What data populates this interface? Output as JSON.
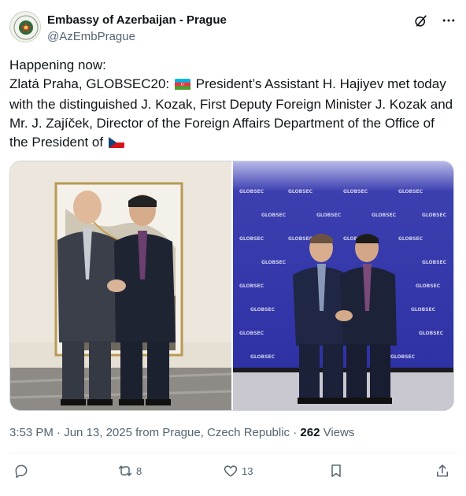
{
  "account": {
    "name": "Embassy of Azerbaijan - Prague",
    "handle": "@AzEmbPrague",
    "avatar_icon": "embassy-seal-icon"
  },
  "header_icons": [
    "grok-icon",
    "more-icon"
  ],
  "tweet": {
    "line1": "Happening now:",
    "line2_prefix": "Zlatá Praha, GLOBSEC20: ",
    "line2_suffix": " President’s Assistant H. Hajiyev met today with the distinguished J. Kozak, First Deputy Foreign Minister J. Kozak and Mr. J. Zajíček, Director of the Foreign Affairs Department of the Office of the President of ",
    "flags": [
      "azerbaijan-flag-icon",
      "czech-flag-icon"
    ]
  },
  "media": {
    "photo_left_icon": "photo-handshake-hotel",
    "photo_right_icon": "photo-handshake-globsec",
    "backdrop_logo": "GLOBSEC"
  },
  "meta": {
    "time": "3:53 PM",
    "separator": " · ",
    "date": "Jun 13, 2025",
    "location": " from Prague, Czech Republic",
    "views_count": "262",
    "views_label": " Views"
  },
  "actions": {
    "reply_count": "",
    "retweet_count": "8",
    "like_count": "13"
  },
  "colors": {
    "text_primary": "#0f1419",
    "text_secondary": "#536471",
    "border": "#cfd9de"
  }
}
